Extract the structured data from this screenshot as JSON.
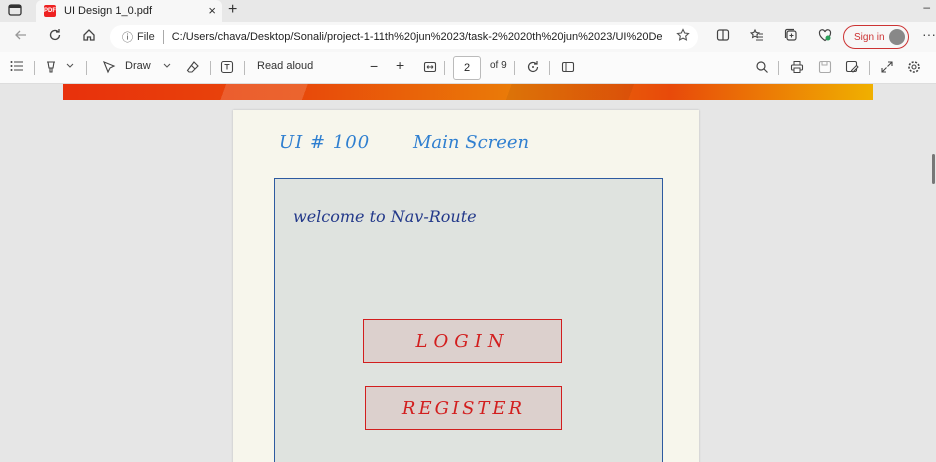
{
  "browser": {
    "tab": {
      "title": "UI Design 1_0.pdf",
      "favicon_text": "PDF"
    },
    "new_tab_label": "+",
    "tab_close_label": "×",
    "minimize_label": "–",
    "url": {
      "info_label": "ⓘ",
      "scheme_label": "File",
      "text": "C:/Users/chava/Desktop/Sonali/project-1-11th%20jun%2023/task-2%2020th%20jun%2023/UI%20De..."
    },
    "sign_in_label": "Sign in",
    "more_label": "···"
  },
  "pdf_toolbar": {
    "draw_label": "Draw",
    "read_aloud_label": "Read aloud",
    "zoom_out_label": "−",
    "zoom_in_label": "+",
    "page_current": "2",
    "page_total": "of 9"
  },
  "document": {
    "heading": "UI # 100",
    "subheading": "Main Screen",
    "welcome_text": "welcome to Nav-Route",
    "login_label": "LOGIN",
    "register_label": "REGISTER"
  },
  "colors": {
    "accent_blue": "#2f7fd0",
    "button_red": "#d21e1e",
    "ink_navy": "#23398a",
    "signin_red": "#c33333"
  }
}
